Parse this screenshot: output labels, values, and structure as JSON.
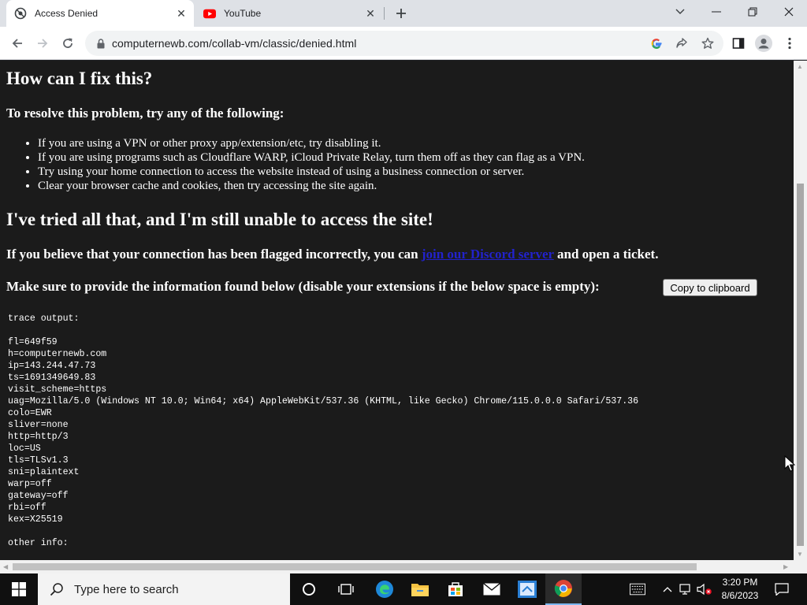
{
  "browser": {
    "tabs": [
      {
        "title": "Access Denied",
        "active": true,
        "favicon": "cloudflare-shield-icon"
      },
      {
        "title": "YouTube",
        "active": false,
        "favicon": "youtube-icon"
      }
    ],
    "url": "computernewb.com/collab-vm/classic/denied.html"
  },
  "page": {
    "heading_fix": "How can I fix this?",
    "subheading_resolve": "To resolve this problem, try any of the following:",
    "tips": [
      "If you are using a VPN or other proxy app/extension/etc, try disabling it.",
      "If you are using programs such as Cloudflare WARP, iCloud Private Relay, turn them off as they can flag as a VPN.",
      "Try using your home connection to access the website instead of using a business connection or server.",
      "Clear your browser cache and cookies, then try accessing the site again."
    ],
    "heading_tried": "I've tried all that, and I'm still unable to access the site!",
    "flagged_before": "If you believe that your connection has been flagged incorrectly, you can",
    "flagged_link": "join our Discord server",
    "flagged_after": "and open a ticket.",
    "provide_info": "Make sure to provide the information found below (disable your extensions if the below space is empty):",
    "copy_button": "Copy to clipboard",
    "trace_text": "trace output:\n\nfl=649f59\nh=computernewb.com\nip=143.244.47.73\nts=1691349649.83\nvisit_scheme=https\nuag=Mozilla/5.0 (Windows NT 10.0; Win64; x64) AppleWebKit/537.36 (KHTML, like Gecko) Chrome/115.0.0.0 Safari/537.36\ncolo=EWR\nsliver=none\nhttp=http/3\nloc=US\ntls=TLSv1.3\nsni=plaintext\nwarp=off\ngateway=off\nrbi=off\nkex=X25519\n\nother info:"
  },
  "taskbar": {
    "search_placeholder": "Type here to search",
    "time": "3:20 PM",
    "date": "8/6/2023"
  },
  "colors": {
    "page_bg": "#1b1b1b",
    "link": "#2222cc",
    "tabstrip": "#dee1e6"
  }
}
